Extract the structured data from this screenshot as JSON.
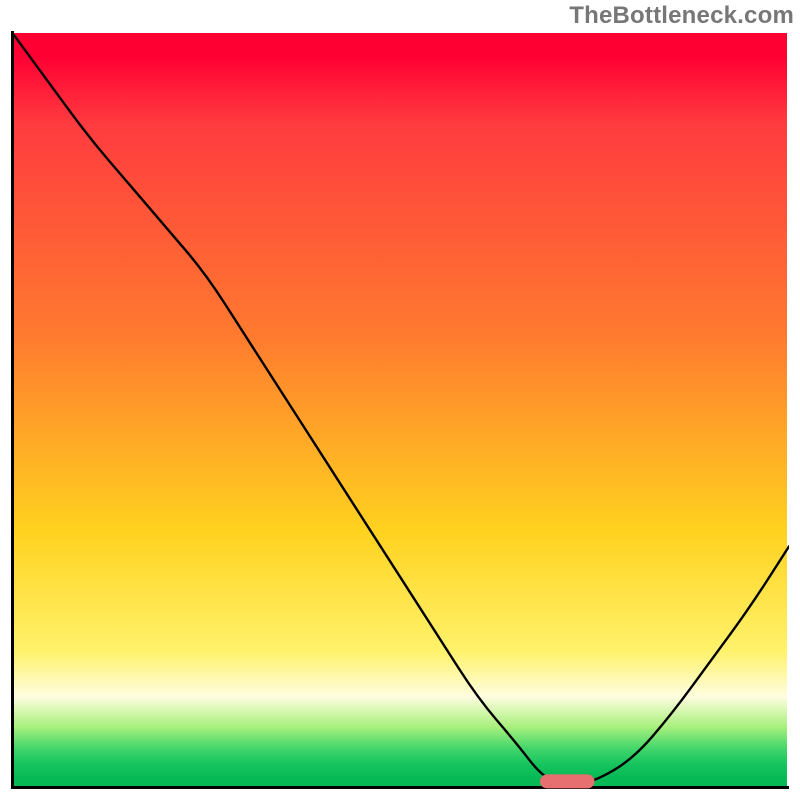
{
  "watermark": "TheBottleneck.com",
  "chart_data": {
    "type": "line",
    "title": "",
    "xlabel": "",
    "ylabel": "",
    "xlim": [
      0,
      100
    ],
    "ylim": [
      0,
      100
    ],
    "grid": false,
    "legend": false,
    "series": [
      {
        "name": "curve",
        "x": [
          0,
          5,
          10,
          15,
          20,
          25,
          30,
          35,
          40,
          45,
          50,
          55,
          60,
          65,
          68,
          70,
          73,
          75,
          80,
          85,
          90,
          95,
          100
        ],
        "values": [
          100,
          93,
          86,
          80,
          74,
          68,
          60,
          52,
          44,
          36,
          28,
          20,
          12,
          6,
          2,
          1,
          1,
          1,
          4,
          10,
          17,
          24,
          32
        ]
      }
    ],
    "marker": {
      "x_start": 68,
      "x_end": 75,
      "y": 1,
      "color": "#e76f6f"
    },
    "background_gradient": {
      "top": "#ff0033",
      "mid": "#ffd21f",
      "bottom": "#06b955"
    }
  }
}
